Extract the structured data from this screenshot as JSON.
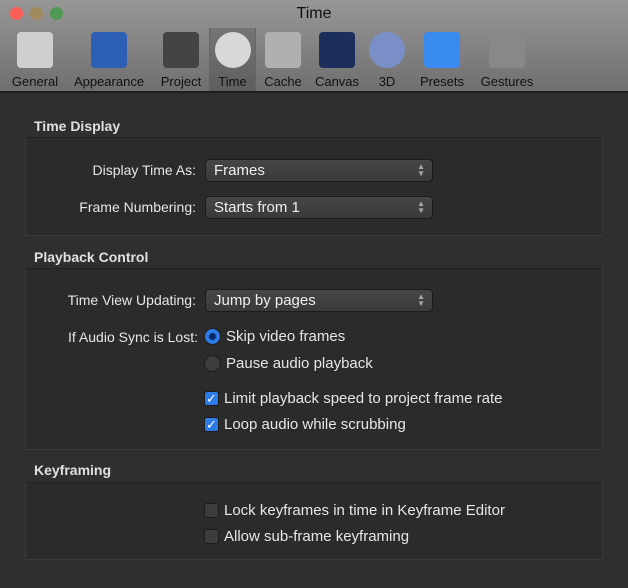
{
  "window": {
    "title": "Time"
  },
  "toolbar": {
    "items": [
      {
        "label": "General",
        "color": "#cfcfcf"
      },
      {
        "label": "Appearance",
        "color": "#2d5fb5"
      },
      {
        "label": "Project",
        "color": "#444"
      },
      {
        "label": "Time",
        "color": "#d8d8d8"
      },
      {
        "label": "Cache",
        "color": "#b0b0b0"
      },
      {
        "label": "Canvas",
        "color": "#1c2f5c"
      },
      {
        "label": "3D",
        "color": "#7a8fc8"
      },
      {
        "label": "Presets",
        "color": "#3a8bf0"
      },
      {
        "label": "Gestures",
        "color": "#888"
      }
    ]
  },
  "time_display": {
    "heading": "Time Display",
    "display_time_as_label": "Display Time As:",
    "display_time_as_value": "Frames",
    "frame_numbering_label": "Frame Numbering:",
    "frame_numbering_value": "Starts from 1"
  },
  "playback": {
    "heading": "Playback Control",
    "time_view_label": "Time View Updating:",
    "time_view_value": "Jump by pages",
    "audio_sync_label": "If Audio Sync is Lost:",
    "radio_skip": "Skip video frames",
    "radio_pause": "Pause audio playback",
    "limit_speed": "Limit playback speed to project frame rate",
    "loop_audio": "Loop audio while scrubbing"
  },
  "keyframing": {
    "heading": "Keyframing",
    "lock_keyframes": "Lock keyframes in time in Keyframe Editor",
    "subframe": "Allow sub-frame keyframing"
  }
}
